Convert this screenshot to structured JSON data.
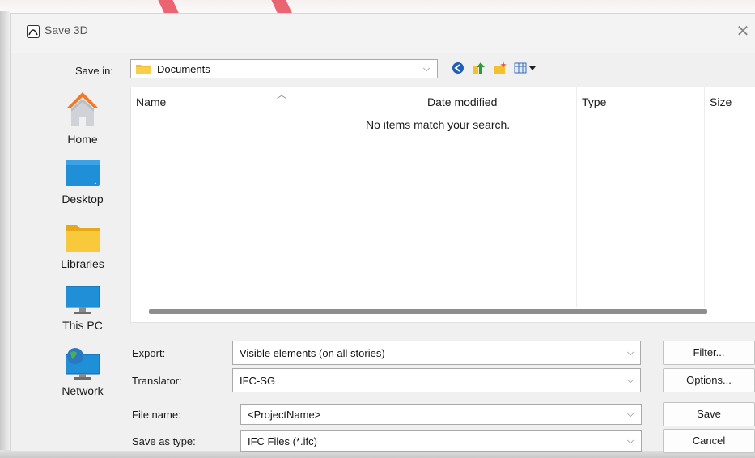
{
  "window": {
    "title": "Save 3D",
    "close_glyph": "✕"
  },
  "save_in": {
    "label": "Save in:",
    "value": "Documents"
  },
  "toolbar": {
    "icons": [
      "back-icon",
      "up-folder-icon",
      "new-folder-icon",
      "view-menu-icon"
    ]
  },
  "places": [
    {
      "label": "Home",
      "icon": "home-icon"
    },
    {
      "label": "Desktop",
      "icon": "desktop-icon"
    },
    {
      "label": "Libraries",
      "icon": "libraries-icon"
    },
    {
      "label": "This PC",
      "icon": "this-pc-icon"
    },
    {
      "label": "Network",
      "icon": "network-icon"
    }
  ],
  "file_list": {
    "columns": [
      "Name",
      "Date modified",
      "Type",
      "Size"
    ],
    "empty_message": "No items match your search."
  },
  "export": {
    "label": "Export:",
    "value": "Visible elements (on all stories)"
  },
  "translator": {
    "label": "Translator:",
    "value": "IFC-SG"
  },
  "file_name": {
    "label": "File name:",
    "value": "<ProjectName>"
  },
  "save_as_type": {
    "label": "Save as type:",
    "value": "IFC Files (*.ifc)"
  },
  "buttons": {
    "filter": "Filter...",
    "options": "Options...",
    "save": "Save",
    "cancel": "Cancel"
  },
  "colors": {
    "accent_stripe": "#e84a5a",
    "folder": "#f5c02f",
    "desktop": "#1f8fd8"
  }
}
